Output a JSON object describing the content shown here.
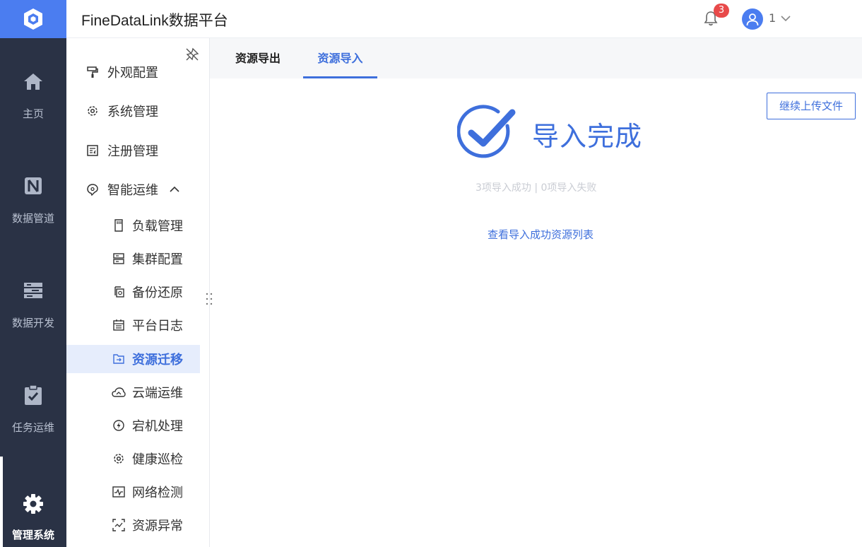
{
  "header": {
    "title": "FineDataLink数据平台",
    "notifications": "3",
    "user": "1"
  },
  "rail": [
    {
      "label": "主页",
      "icon": "home-icon"
    },
    {
      "label": "数据管道",
      "icon": "pipeline-icon"
    },
    {
      "label": "数据开发",
      "icon": "data-dev-icon"
    },
    {
      "label": "任务运维",
      "icon": "task-ops-icon"
    },
    {
      "label": "管理系统",
      "icon": "gear-icon"
    }
  ],
  "submenu": [
    {
      "label": "外观配置",
      "icon": "paint-roller-icon"
    },
    {
      "label": "系统管理",
      "icon": "gear-icon"
    },
    {
      "label": "注册管理",
      "icon": "register-icon"
    },
    {
      "label": "智能运维",
      "icon": "smart-ops-icon"
    },
    {
      "label": "负载管理",
      "icon": "sd-card-icon"
    },
    {
      "label": "集群配置",
      "icon": "server-icon"
    },
    {
      "label": "备份还原",
      "icon": "backup-icon"
    },
    {
      "label": "平台日志",
      "icon": "calendar-icon"
    },
    {
      "label": "资源迁移",
      "icon": "folder-arrow-icon"
    },
    {
      "label": "云端运维",
      "icon": "cloud-icon"
    },
    {
      "label": "宕机处理",
      "icon": "lightning-icon"
    },
    {
      "label": "健康巡检",
      "icon": "gear-icon"
    },
    {
      "label": "网络检测",
      "icon": "network-chart-icon"
    },
    {
      "label": "资源异常",
      "icon": "scan-icon"
    }
  ],
  "tabs": [
    {
      "label": "资源导出"
    },
    {
      "label": "资源导入"
    }
  ],
  "main": {
    "upload_button": "继续上传文件",
    "result_title": "导入完成",
    "summary": "3项导入成功 | 0项导入失败",
    "view_link": "查看导入成功资源列表"
  },
  "colors": {
    "accent": "#3e6fdc",
    "rail_bg": "#2a3245",
    "logo_bg": "#4b7df0",
    "badge": "#e84a4a"
  }
}
